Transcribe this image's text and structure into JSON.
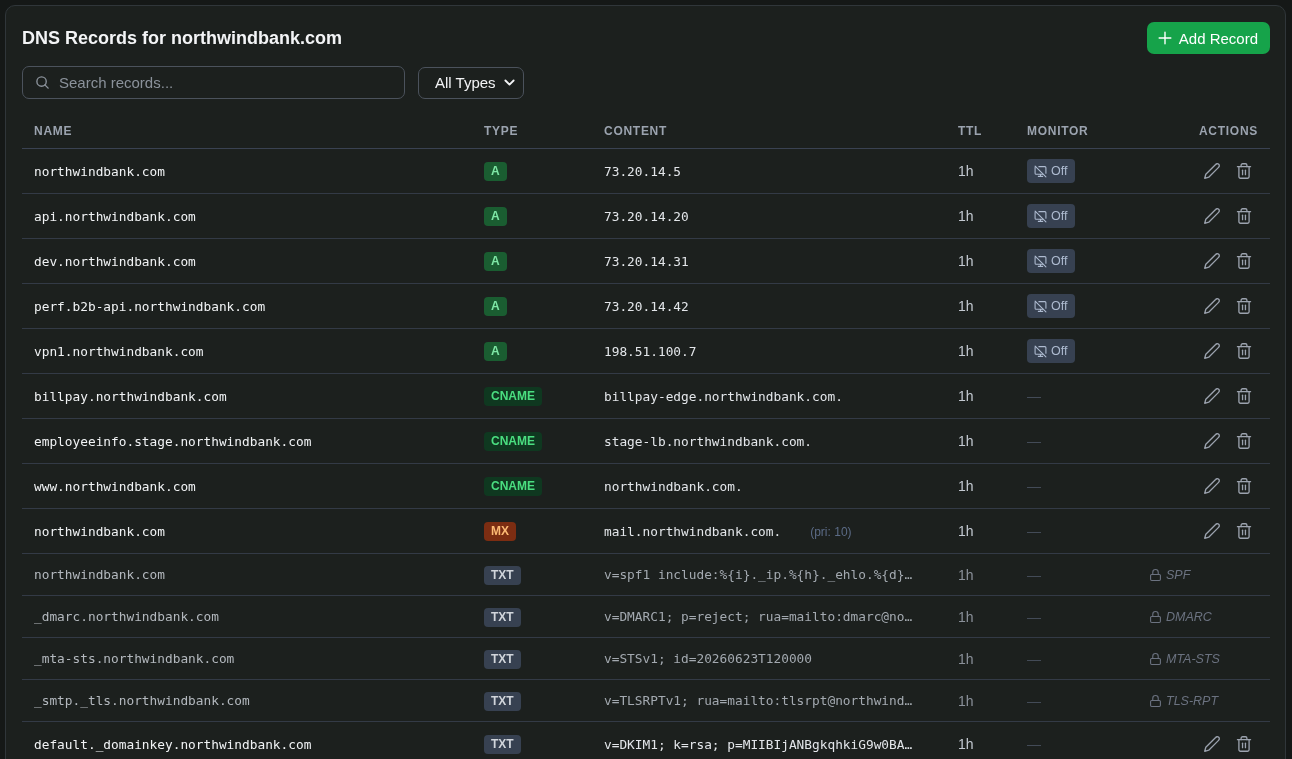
{
  "title": "DNS Records for northwindbank.com",
  "add_button": {
    "label": "Add Record"
  },
  "search": {
    "placeholder": "Search records..."
  },
  "type_filter": {
    "value": "All Types"
  },
  "table": {
    "columns": [
      "NAME",
      "TYPE",
      "CONTENT",
      "TTL",
      "MONITOR",
      "ACTIONS"
    ],
    "rows": [
      {
        "name": "northwindbank.com",
        "type": {
          "label": "A",
          "kind": "a"
        },
        "content": "73.20.14.5",
        "ttl": "1h",
        "monitor": {
          "kind": "pill",
          "label": "Off",
          "on": false
        },
        "locked": false
      },
      {
        "name": "api.northwindbank.com",
        "type": {
          "label": "A",
          "kind": "a"
        },
        "content": "73.20.14.20",
        "ttl": "1h",
        "monitor": {
          "kind": "pill",
          "label": "Off",
          "on": false
        },
        "locked": false
      },
      {
        "name": "dev.northwindbank.com",
        "type": {
          "label": "A",
          "kind": "a"
        },
        "content": "73.20.14.31",
        "ttl": "1h",
        "monitor": {
          "kind": "pill",
          "label": "Off",
          "on": false
        },
        "locked": false
      },
      {
        "name": "perf.b2b-api.northwindbank.com",
        "type": {
          "label": "A",
          "kind": "a"
        },
        "content": "73.20.14.42",
        "ttl": "1h",
        "monitor": {
          "kind": "pill",
          "label": "Off",
          "on": false
        },
        "locked": false
      },
      {
        "name": "vpn1.northwindbank.com",
        "type": {
          "label": "A",
          "kind": "a"
        },
        "content": "198.51.100.7",
        "ttl": "1h",
        "monitor": {
          "kind": "pill",
          "label": "Off",
          "on": false
        },
        "locked": false
      },
      {
        "name": "billpay.northwindbank.com",
        "type": {
          "label": "CNAME",
          "kind": "cname"
        },
        "content": "billpay-edge.northwindbank.com.",
        "ttl": "1h",
        "monitor": {
          "kind": "dash",
          "label": "—"
        },
        "locked": false
      },
      {
        "name": "employeeinfo.stage.northwindbank.com",
        "type": {
          "label": "CNAME",
          "kind": "cname"
        },
        "content": "stage-lb.northwindbank.com.",
        "ttl": "1h",
        "monitor": {
          "kind": "dash",
          "label": "—"
        },
        "locked": false
      },
      {
        "name": "www.northwindbank.com",
        "type": {
          "label": "CNAME",
          "kind": "cname"
        },
        "content": "northwindbank.com.",
        "ttl": "1h",
        "monitor": {
          "kind": "dash",
          "label": "—"
        },
        "locked": false
      },
      {
        "name": "northwindbank.com",
        "type": {
          "label": "MX",
          "kind": "mx"
        },
        "content": "mail.northwindbank.com.",
        "priority": "(pri: 10)",
        "ttl": "1h",
        "monitor": {
          "kind": "dash",
          "label": "—"
        },
        "locked": false
      },
      {
        "name": "northwindbank.com",
        "type": {
          "label": "TXT",
          "kind": "txt"
        },
        "content": "v=spf1 include:%{i}._ip.%{h}._ehlo.%{d}…",
        "ttl": "1h",
        "monitor": {
          "kind": "dash",
          "label": "—"
        },
        "locked": true,
        "lock_label": "SPF"
      },
      {
        "name": "_dmarc.northwindbank.com",
        "type": {
          "label": "TXT",
          "kind": "txt"
        },
        "content": "v=DMARC1; p=reject; rua=mailto:dmarc@no…",
        "ttl": "1h",
        "monitor": {
          "kind": "dash",
          "label": "—"
        },
        "locked": true,
        "lock_label": "DMARC"
      },
      {
        "name": "_mta-sts.northwindbank.com",
        "type": {
          "label": "TXT",
          "kind": "txt"
        },
        "content": "v=STSv1; id=20260623T120000",
        "ttl": "1h",
        "monitor": {
          "kind": "dash",
          "label": "—"
        },
        "locked": true,
        "lock_label": "MTA-STS"
      },
      {
        "name": "_smtp._tls.northwindbank.com",
        "type": {
          "label": "TXT",
          "kind": "txt"
        },
        "content": "v=TLSRPTv1; rua=mailto:tlsrpt@northwind…",
        "ttl": "1h",
        "monitor": {
          "kind": "dash",
          "label": "—"
        },
        "locked": true,
        "lock_label": "TLS-RPT"
      },
      {
        "name": "default._domainkey.northwindbank.com",
        "type": {
          "label": "TXT",
          "kind": "txt"
        },
        "content": "v=DKIM1; k=rsa; p=MIIBIjANBgkqhkiG9w0BA…",
        "ttl": "1h",
        "monitor": {
          "kind": "dash",
          "label": "—"
        },
        "locked": false
      }
    ]
  }
}
